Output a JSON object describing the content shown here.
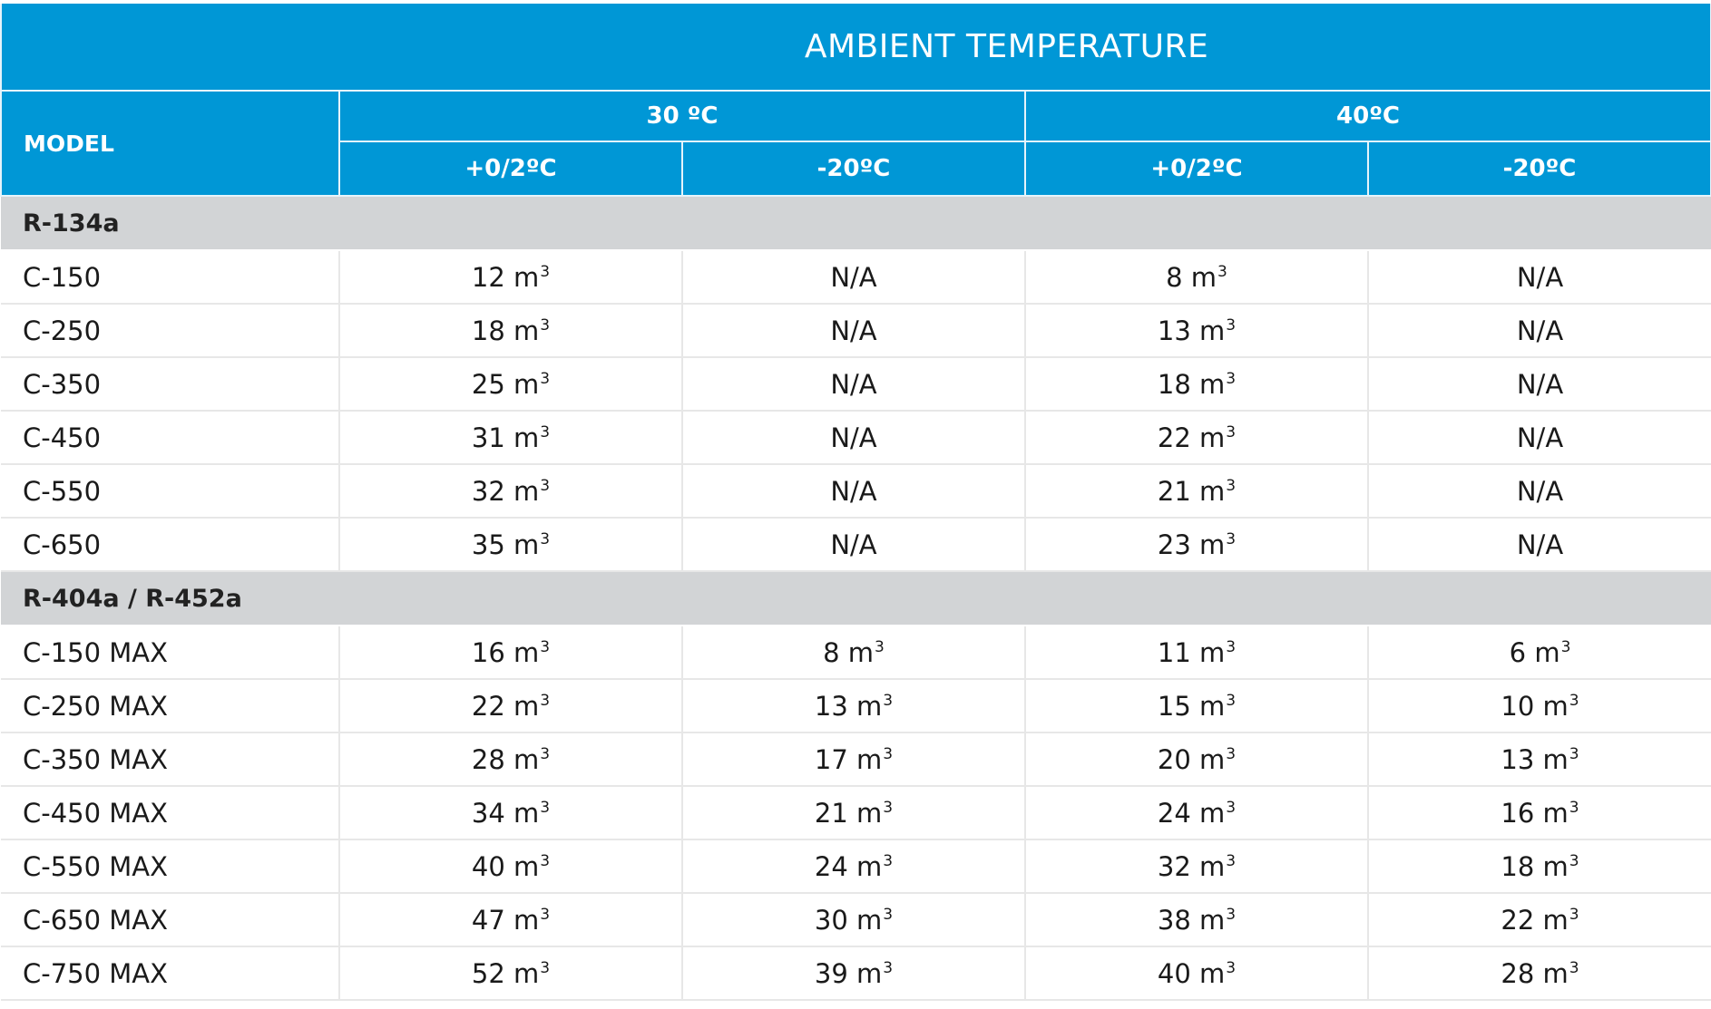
{
  "header": {
    "title": "AMBIENT TEMPERATURE",
    "model_label": "MODEL",
    "temps": [
      "30 ºC",
      "40ºC"
    ],
    "subcols": [
      "+0/2ºC",
      "-20ºC",
      "+0/2ºC",
      "-20ºC"
    ]
  },
  "unit": "m",
  "unit_sup": "3",
  "groups": [
    {
      "name": "R-134a",
      "rows": [
        {
          "model": "C-150",
          "cells": [
            "12",
            "N/A",
            "8",
            "N/A"
          ]
        },
        {
          "model": "C-250",
          "cells": [
            "18",
            "N/A",
            "13",
            "N/A"
          ]
        },
        {
          "model": "C-350",
          "cells": [
            "25",
            "N/A",
            "18",
            "N/A"
          ]
        },
        {
          "model": "C-450",
          "cells": [
            "31",
            "N/A",
            "22",
            "N/A"
          ]
        },
        {
          "model": "C-550",
          "cells": [
            "32",
            "N/A",
            "21",
            "N/A"
          ]
        },
        {
          "model": "C-650",
          "cells": [
            "35",
            "N/A",
            "23",
            "N/A"
          ]
        }
      ]
    },
    {
      "name": "R-404a / R-452a",
      "rows": [
        {
          "model": "C-150 MAX",
          "cells": [
            "16",
            "8",
            "11",
            "6"
          ]
        },
        {
          "model": "C-250 MAX",
          "cells": [
            "22",
            "13",
            "15",
            "10"
          ]
        },
        {
          "model": "C-350 MAX",
          "cells": [
            "28",
            "17",
            "20",
            "13"
          ]
        },
        {
          "model": "C-450 MAX",
          "cells": [
            "34",
            "21",
            "24",
            "16"
          ]
        },
        {
          "model": "C-550 MAX",
          "cells": [
            "40",
            "24",
            "32",
            "18"
          ]
        },
        {
          "model": "C-650 MAX",
          "cells": [
            "47",
            "30",
            "38",
            "22"
          ]
        },
        {
          "model": "C-750 MAX",
          "cells": [
            "52",
            "39",
            "40",
            "28"
          ]
        }
      ]
    }
  ]
}
